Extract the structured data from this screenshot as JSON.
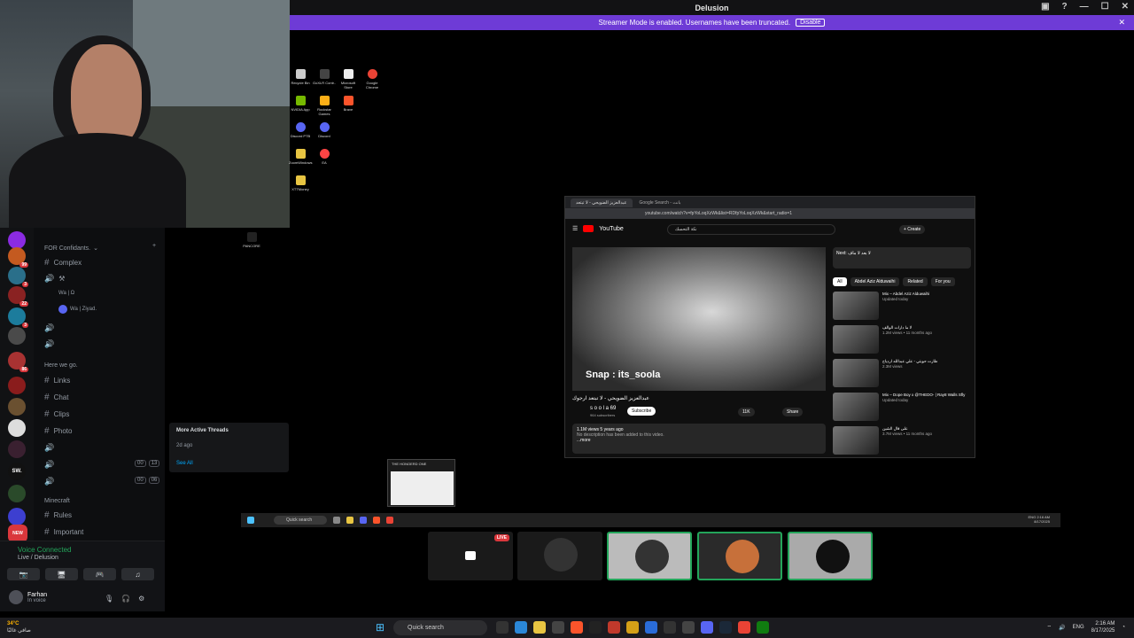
{
  "window": {
    "title": "Delusion"
  },
  "streamer_banner": {
    "text": "Streamer Mode is enabled. Usernames have been truncated.",
    "button": "Disable"
  },
  "channels": {
    "cat1": "FOR Confidants.",
    "ch_complex": "Complex",
    "vc_user1": "Wa | Ω",
    "vc_user2": "Wa | Ziyad.",
    "cat2": "Here we go.",
    "ch_links": "Links",
    "ch_chat": "Chat",
    "ch_clips": "Clips",
    "ch_photo": "Photo",
    "vc_tag_a": "00",
    "vc_tag_b": "13",
    "vc_tag_c": "00",
    "vc_tag_d": "06",
    "cat3": "Minecraft",
    "ch_rules": "Rules",
    "ch_important": "Important"
  },
  "servers": [
    {
      "badge": "99"
    },
    {
      "badge": "3"
    },
    {
      "badge": "22"
    },
    {
      "badge": "3"
    },
    {
      "badge": "86"
    },
    {
      "label": "SW."
    },
    {
      "label": "NEW"
    }
  ],
  "voice": {
    "title": "Voice Connected",
    "sub": "Live / Delusion",
    "user": "Farhan",
    "status": "In voice"
  },
  "threads": {
    "title": "More Active Threads",
    "item": "2d ago",
    "see_all": "See All"
  },
  "desktop_icons": [
    "Recycle Bin",
    "GoXLR Contr..",
    "Microsoft Store",
    "Google Chrome",
    "NVIDIA App",
    "Rockstar Games",
    "Brave",
    "Discord PTB",
    "Discord",
    "ZoomWindows",
    "EA",
    "XTTMoney",
    "PANCORE"
  ],
  "browser": {
    "tab1": "عبدالعزيز الضويحي - لا تبتعد",
    "tab2": "Google Search - بانت",
    "url": "youtube.com/watch?v=fpYoLoqXzWk&list=RDfpYoLoqXzWk&start_radio=1",
    "search": "نكة التحسك",
    "create": "+ Create",
    "snap": "Snap : its_soola",
    "video_title": "عبدالعزيز الضويحي - لا تبتعد ارجوك",
    "channel": "s o o l a 69",
    "subs": "964 subscribers",
    "subscribe": "Subscribe",
    "likes": "11K",
    "share": "Share",
    "views": "1.1M views  5 years ago",
    "desc": "No description has been added to this video.",
    "more": "...more",
    "next": "Next: لا بعد لا ماف",
    "chips": [
      "All",
      "Abdel Aziz Alduwaihi",
      "Related",
      "For you"
    ],
    "recs": [
      {
        "title": "Mix – Abdel Aziz Alduwaihi",
        "meta": "Updated today"
      },
      {
        "title": "لا ما دارات الوالف",
        "meta": "1.2M views • 11 months ago"
      },
      {
        "title": "طارت حوبتي - علي عبدالله اردياح",
        "meta": "2.3M views"
      },
      {
        "title": "Mix – Dope Boy x @THEDO- | Ray8 Walls Sfly",
        "meta": "Updated today"
      },
      {
        "title": "على قال الشين",
        "meta": "3.7M views • 11 months ago"
      }
    ]
  },
  "mini_notify": "THE HONOERD ONE",
  "inner_taskbar": {
    "search": "Quick search",
    "time": "2:16 AM",
    "date": "8/17/2025",
    "lang": "ENG"
  },
  "main_taskbar": {
    "search": "Quick search",
    "weather": "34°C",
    "weather_sub": "صافي غالبًا",
    "lang": "ENG",
    "time": "2:16 AM",
    "date": "8/17/2025"
  },
  "colors": {
    "accent": "#6e3bd6",
    "live": "#da373c",
    "connected": "#23a55a"
  }
}
